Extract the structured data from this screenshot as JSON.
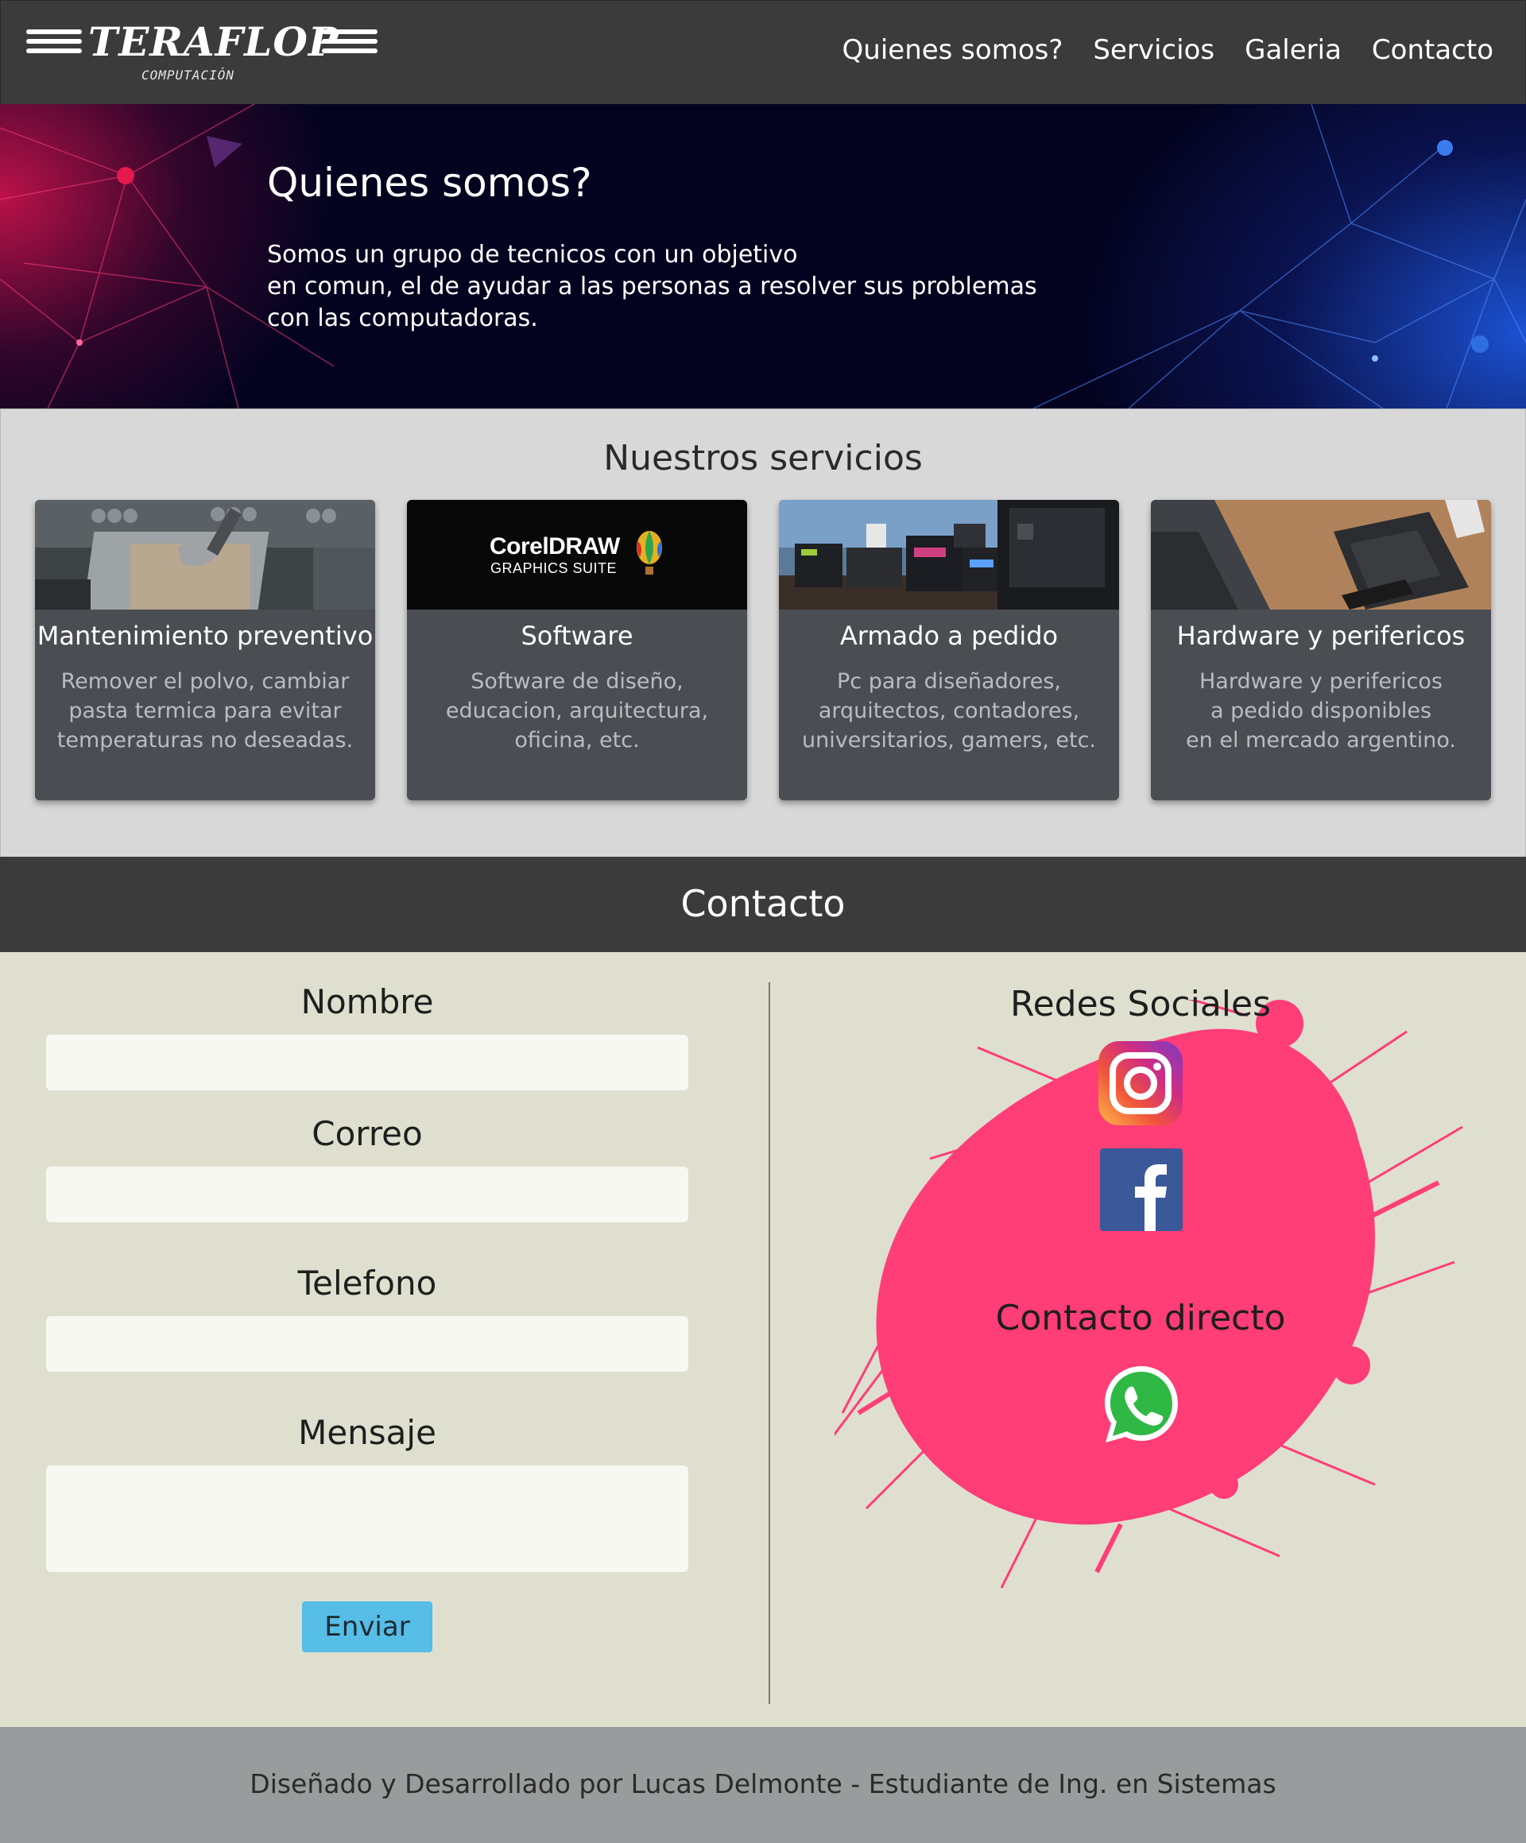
{
  "brand": {
    "name": "TERAFLOP",
    "subtitle": "COMPUTACIÓN"
  },
  "nav": {
    "items": [
      "Quienes somos?",
      "Servicios",
      "Galeria",
      "Contacto"
    ]
  },
  "hero": {
    "title": "Quienes somos?",
    "lines": [
      "Somos un grupo de tecnicos con un objetivo",
      "en comun, el de ayudar a las personas a resolver sus problemas",
      "con las computadoras."
    ]
  },
  "services": {
    "title": "Nuestros servicios",
    "cards": [
      {
        "title": "Mantenimiento preventivo",
        "lines": [
          "Remover el polvo, cambiar",
          "pasta termica para evitar",
          "temperaturas no deseadas."
        ],
        "image": "cpu-thermal-paste-photo"
      },
      {
        "title": "Software",
        "lines": [
          "Software de diseño,",
          "educacion, arquitectura,",
          "oficina, etc."
        ],
        "image": "coreldraw-logo",
        "image_text": [
          "CorelDRAW",
          "GRAPHICS SUITE"
        ]
      },
      {
        "title": "Armado a pedido",
        "lines": [
          "Pc para diseñadores,",
          "arquitectos, contadores,",
          "universitarios, gamers, etc."
        ],
        "image": "pc-parts-boxes-photo"
      },
      {
        "title": "Hardware y perifericos",
        "lines": [
          "Hardware y perifericos",
          "a pedido disponibles",
          "en el mercado argentino."
        ],
        "image": "ssd-drives-photo"
      }
    ]
  },
  "contact": {
    "title": "Contacto",
    "form": {
      "name_label": "Nombre",
      "email_label": "Correo",
      "phone_label": "Telefono",
      "message_label": "Mensaje",
      "name_value": "",
      "email_value": "",
      "phone_value": "",
      "message_value": "",
      "submit_label": "Enviar"
    },
    "social_title": "Redes Sociales",
    "direct_title": "Contacto directo",
    "icons": [
      "instagram-icon",
      "facebook-icon",
      "whatsapp-icon"
    ]
  },
  "footer": {
    "text": "Diseñado y Desarrollado por Lucas Delmonte - Estudiante de Ing. en Sistemas"
  },
  "colors": {
    "header_bg": "#3b3b3b",
    "services_bg": "#d8d8d8",
    "card_bg": "#4a4d52",
    "contact_bg": "#dfdfcf",
    "button_bg": "#55bde6",
    "splash": "#ff3d77",
    "footer_bg": "#999c9c"
  }
}
